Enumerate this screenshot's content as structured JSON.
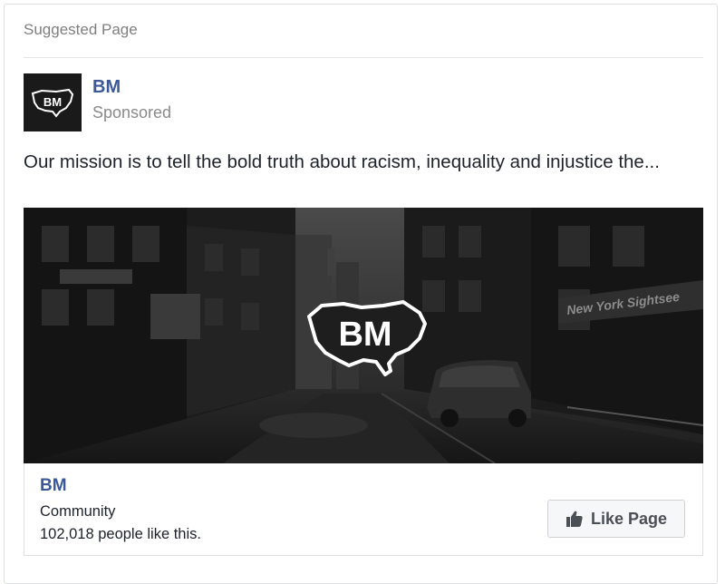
{
  "header": {
    "label": "Suggested Page"
  },
  "post": {
    "page_name": "BM",
    "sponsored_label": "Sponsored",
    "text": "Our mission is to tell the bold truth about racism, inequality and injustice the...",
    "avatar_logo_text": "BM",
    "hero_logo_text": "BM",
    "hero_sign_text": "New York Sightsee"
  },
  "footer": {
    "title": "BM",
    "category": "Community",
    "likes": "102,018 people like this.",
    "like_button_label": "Like Page"
  },
  "colors": {
    "link_blue": "#3b5998",
    "muted_gray": "#7f7f7f",
    "button_bg": "#f6f7f9"
  },
  "icons": {
    "like": "thumbs-up-icon"
  }
}
